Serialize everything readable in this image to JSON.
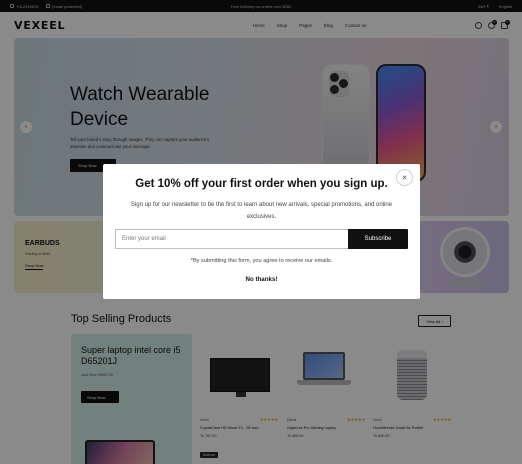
{
  "topbar": {
    "phone": "+012345678",
    "email": "[email protected]",
    "promo": "Free Delivery on orders over $250",
    "currency": "INR ₹",
    "language": "English"
  },
  "nav": {
    "logo": "VEXEEL",
    "items": [
      {
        "label": "Home"
      },
      {
        "label": "Shop"
      },
      {
        "label": "Pages"
      },
      {
        "label": "Blog"
      },
      {
        "label": "Contact us"
      }
    ],
    "wishlist_count": "0",
    "cart_count": "0"
  },
  "hero": {
    "title": "Watch Wearable Device",
    "text": "Tell your brand's story through images. They can capture your audience's attention and communicate your message",
    "button": "Shop Now",
    "prev": "‹",
    "next": "›"
  },
  "promos": [
    {
      "title": "EARBUDS",
      "start": "Starting at $669",
      "link": "Shop Now"
    }
  ],
  "products_section": {
    "title": "Top Selling Products",
    "view_all": "View All",
    "feature": {
      "title": "Super laptop intel core i5 D65201J",
      "from": "Just from $699.00",
      "button": "Shop Now"
    },
    "items": [
      {
        "category": "Vexel",
        "name": "CrystalClear HD Smart TV - 55 Inch",
        "price": "Tk 787.00",
        "stars": "★★★★★",
        "soldout": "Sold out"
      },
      {
        "category": "Direct",
        "name": "GigaCore Pro Gaming Laptop",
        "price": "Tk 865.00",
        "stars": "★★★★★"
      },
      {
        "category": "Vexel",
        "name": "HomeBreeze Smart Air Purifier",
        "price": "Tk 840.00",
        "stars": "★★★★★"
      }
    ]
  },
  "modal": {
    "title": "Get 10% off your first order when you sign up.",
    "description": "Sign up for our newsletter to be the first to learn about new arrivals, special promotions, and online exclusives.",
    "email_placeholder": "Enter your email",
    "subscribe": "Subscribe",
    "terms": "*By submitting this form, you agree to receive our emails.",
    "no_thanks": "No thanks!",
    "close": "✕"
  },
  "colors": {
    "accent": "#111111",
    "star": "#f0a52a",
    "overlay": "rgba(0,0,0,0.46)"
  }
}
